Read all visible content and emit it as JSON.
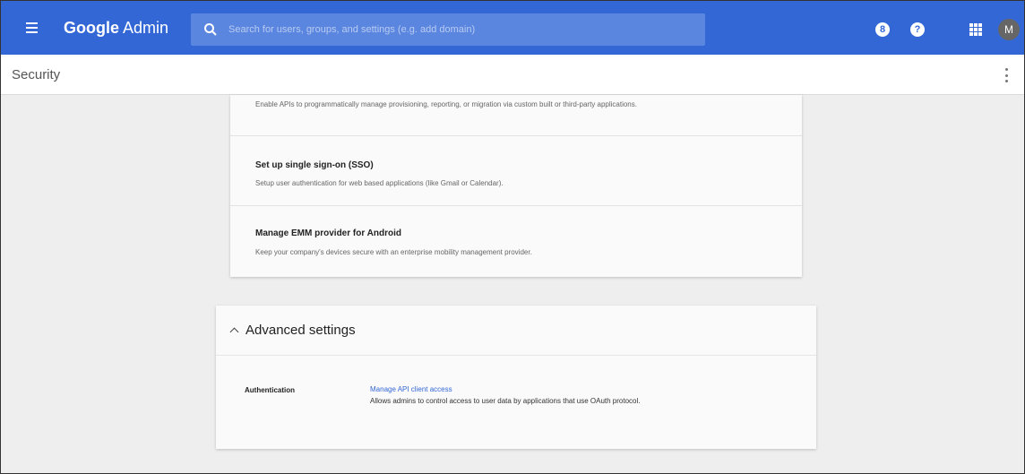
{
  "header": {
    "brand_google": "Google",
    "brand_admin": "Admin",
    "search_placeholder": "Search for users, groups, and settings (e.g. add domain)",
    "support_icon_label": "8",
    "help_icon_label": "?",
    "avatar_initial": "M"
  },
  "page": {
    "title": "Security"
  },
  "card_rows": [
    {
      "title": "",
      "description": "Enable APIs to programmatically manage provisioning, reporting, or migration via custom built or third-party applications."
    },
    {
      "title": "Set up single sign-on (SSO)",
      "description": "Setup user authentication for web based applications (like Gmail or Calendar)."
    },
    {
      "title": "Manage EMM provider for Android",
      "description": "Keep your company's devices secure with an enterprise mobility management provider."
    }
  ],
  "advanced": {
    "title": "Advanced settings",
    "auth_label": "Authentication",
    "link": "Manage API client access",
    "link_desc": "Allows admins to control access to user data by applications that use OAuth protocol."
  },
  "colors": {
    "primary": "#3367d6",
    "link": "#3367d6",
    "background": "#eeeeee"
  }
}
